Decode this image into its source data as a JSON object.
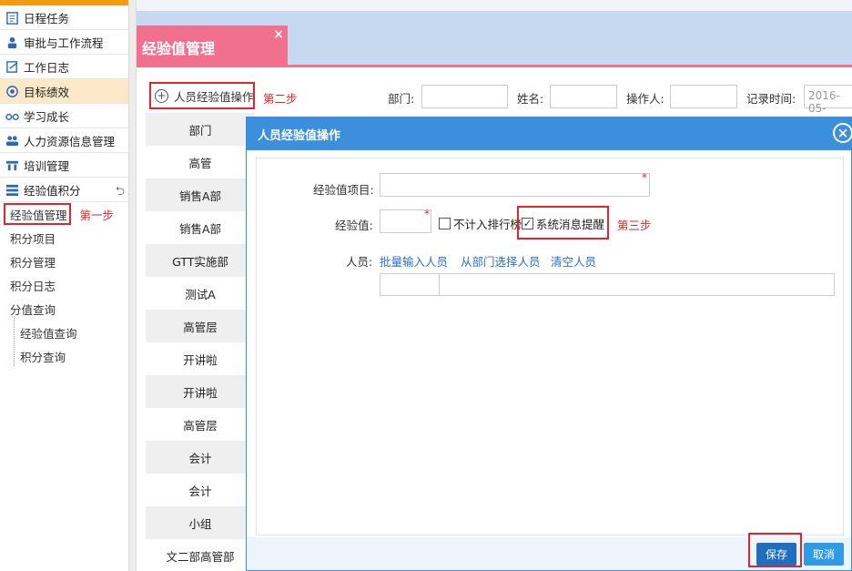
{
  "sidebar": {
    "items": [
      {
        "label": "日程任务",
        "icon": "calendar-icon"
      },
      {
        "label": "审批与工作流程",
        "icon": "approval-person-icon"
      },
      {
        "label": "工作日志",
        "icon": "log-edit-icon"
      },
      {
        "label": "目标绩效",
        "icon": "target-icon"
      },
      {
        "label": "学习成长",
        "icon": "glasses-icon"
      },
      {
        "label": "人力资源信息管理",
        "icon": "people-icon"
      },
      {
        "label": "培训管理",
        "icon": "training-icon"
      },
      {
        "label": "经验值积分",
        "icon": "stack-icon"
      }
    ],
    "sub_items": [
      {
        "label": "经验值管理"
      },
      {
        "label": "积分项目"
      },
      {
        "label": "积分管理"
      },
      {
        "label": "积分日志"
      },
      {
        "label": "分值查询"
      }
    ],
    "sub_sub_items": [
      {
        "label": "经验值查询"
      },
      {
        "label": "积分查询"
      }
    ],
    "step1": "第一步"
  },
  "tab": {
    "title": "经验值管理",
    "close": "×"
  },
  "toolbar": {
    "op_button": "人员经验值操作",
    "step2": "第二步",
    "dept_label": "部门:",
    "name_label": "姓名:",
    "operator_label": "操作人:",
    "record_time_label": "记录时间:",
    "record_time_value": "2016-05-"
  },
  "departments": [
    "部门",
    "高管",
    "销售A部",
    "销售A部",
    "GTT实施部",
    "测试A",
    "高管层",
    "开讲啦",
    "开讲啦",
    "高管层",
    "会计",
    "会计",
    "小组",
    "文二部高管部"
  ],
  "modal": {
    "title": "人员经验值操作",
    "item_label": "经验值项目:",
    "value_label": "经验值:",
    "exclude_rank": "不计入排行榜",
    "system_notify": "系统消息提醒",
    "step3": "第三步",
    "people_label": "人员:",
    "batch_input": "批量输入人员",
    "select_from_dept": "从部门选择人员",
    "clear_people": "清空人员",
    "required_mark": "*",
    "save": "保存",
    "cancel": "取消"
  },
  "colors": {
    "accent_pink": "#f0708e",
    "modal_blue": "#3b8fdc",
    "highlight_red": "#e0262a",
    "link_blue": "#2b72c5"
  }
}
